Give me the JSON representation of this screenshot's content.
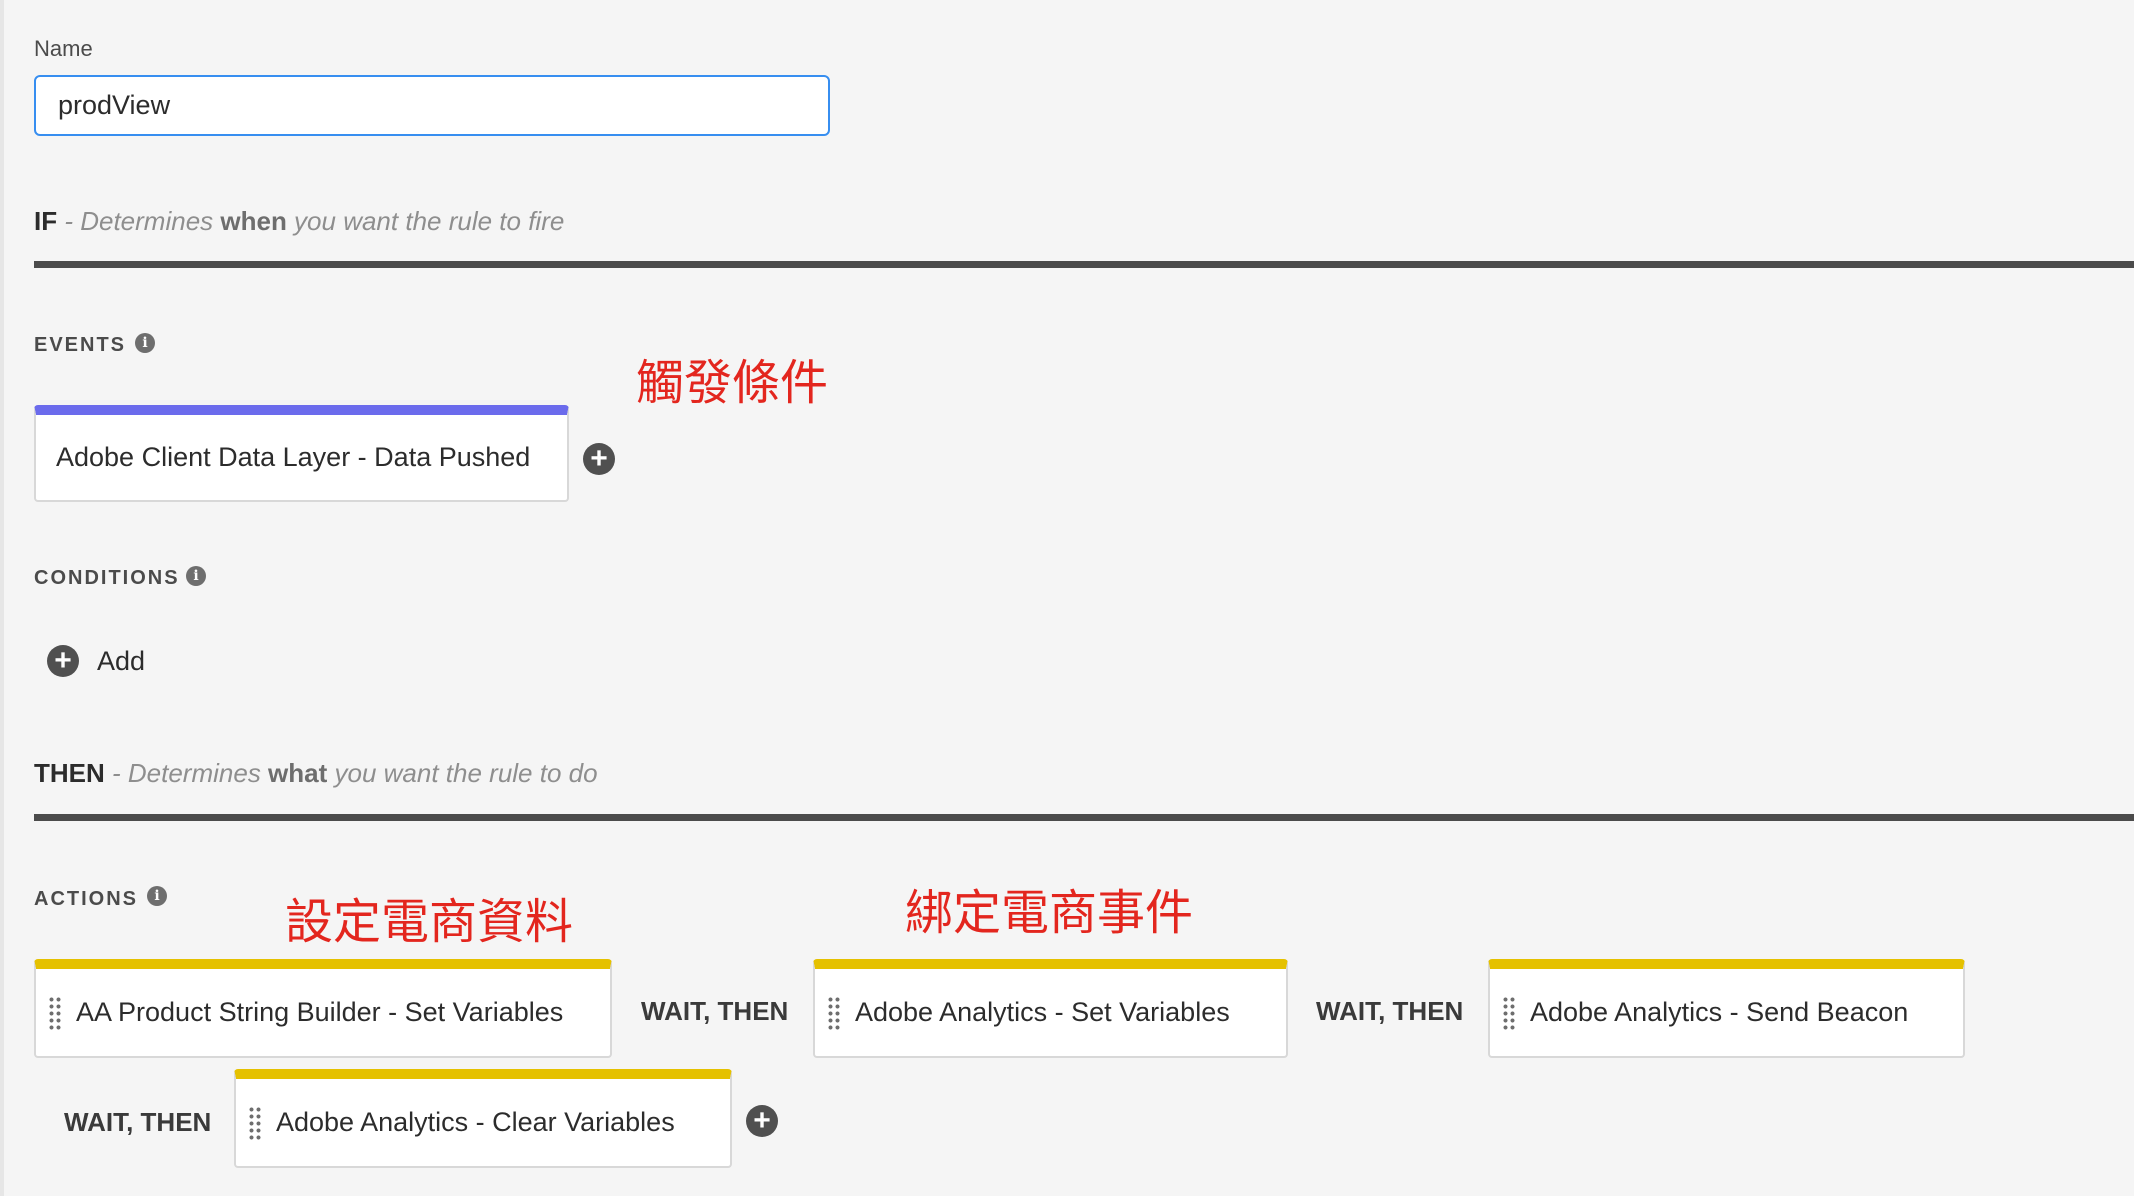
{
  "name_field": {
    "label": "Name",
    "value": "prodView"
  },
  "if_section": {
    "keyword": "IF",
    "desc_pre": " - Determines ",
    "desc_em": "when",
    "desc_post": " you want the rule to fire"
  },
  "events": {
    "label": "EVENTS",
    "items": [
      "Adobe Client Data Layer - Data Pushed"
    ]
  },
  "conditions": {
    "label": "CONDITIONS",
    "add_label": "Add"
  },
  "then_section": {
    "keyword": "THEN",
    "desc_pre": " - Determines ",
    "desc_em": "what",
    "desc_post": " you want the rule to do"
  },
  "actions": {
    "label": "ACTIONS",
    "items": [
      "AA Product String Builder - Set Variables",
      "Adobe Analytics - Set Variables",
      "Adobe Analytics - Send Beacon",
      "Adobe Analytics - Clear Variables"
    ],
    "connector": "WAIT, THEN"
  },
  "annotations": {
    "trigger": "觸發條件",
    "set_data": "設定電商資料",
    "bind_event": "綁定電商事件"
  },
  "colors": {
    "event_bar": "#6b6bec",
    "action_bar": "#e5c100",
    "input_focus": "#378ef0",
    "annotation": "#e3261e"
  },
  "icons": {
    "info": "info-icon",
    "add": "plus-circle-icon",
    "drag": "drag-handle-icon"
  }
}
